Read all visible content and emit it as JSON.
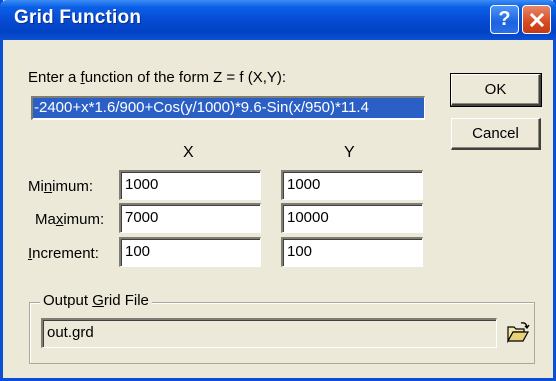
{
  "window": {
    "title": "Grid Function",
    "help_glyph": "?",
    "close_glyph": "✕"
  },
  "prompt": {
    "before": "Enter a ",
    "mnemonic": "f",
    "after": "unction of the form Z = f (X,Y):"
  },
  "formula_value": "-2400+x*1.6/900+Cos(y/1000)*9.6-Sin(x/950)*11.4",
  "buttons": {
    "ok": "OK",
    "cancel": "Cancel"
  },
  "columns": {
    "x": "X",
    "y": "Y"
  },
  "rows": {
    "minimum": {
      "label_pre": "Mi",
      "mnemonic": "n",
      "label_post": "imum:",
      "x": "1000",
      "y": "1000"
    },
    "maximum": {
      "label_pre": "Ma",
      "mnemonic": "x",
      "label_post": "imum:",
      "x": "7000",
      "y": "10000"
    },
    "increment": {
      "label_pre": "",
      "mnemonic": "I",
      "label_post": "ncrement:",
      "x": "100",
      "y": "100"
    }
  },
  "output": {
    "legend_pre": "Output ",
    "mnemonic": "G",
    "legend_post": "rid File",
    "file": "out.grd",
    "browse_icon": "open-folder-icon"
  }
}
